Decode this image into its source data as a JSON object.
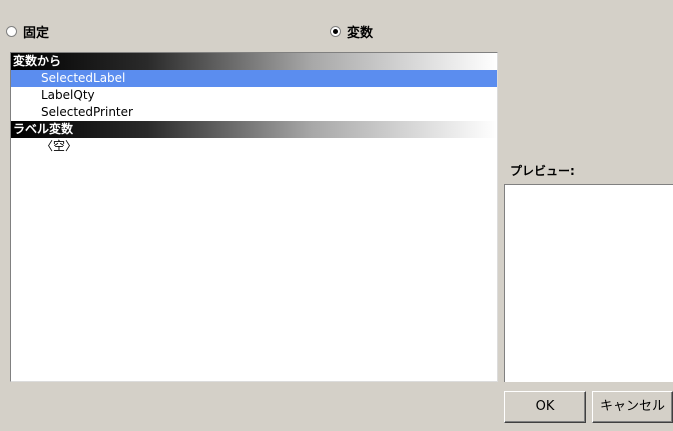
{
  "source_options": {
    "fixed_label": "固定",
    "variable_label": "変数",
    "selected": "variable"
  },
  "list": {
    "groups": [
      {
        "header": "変数から",
        "items": [
          {
            "label": "SelectedLabel",
            "selected": true
          },
          {
            "label": "LabelQty",
            "selected": false
          },
          {
            "label": "SelectedPrinter",
            "selected": false
          }
        ]
      },
      {
        "header": "ラベル変数",
        "items": [
          {
            "label": "〈空〉",
            "selected": false
          }
        ]
      }
    ]
  },
  "preview": {
    "label": "プレビュー:"
  },
  "buttons": {
    "ok_label": "OK",
    "cancel_label": "キャンセル"
  },
  "colors": {
    "selection": "#5b8def",
    "dialog_background": "#d4d0c8"
  }
}
